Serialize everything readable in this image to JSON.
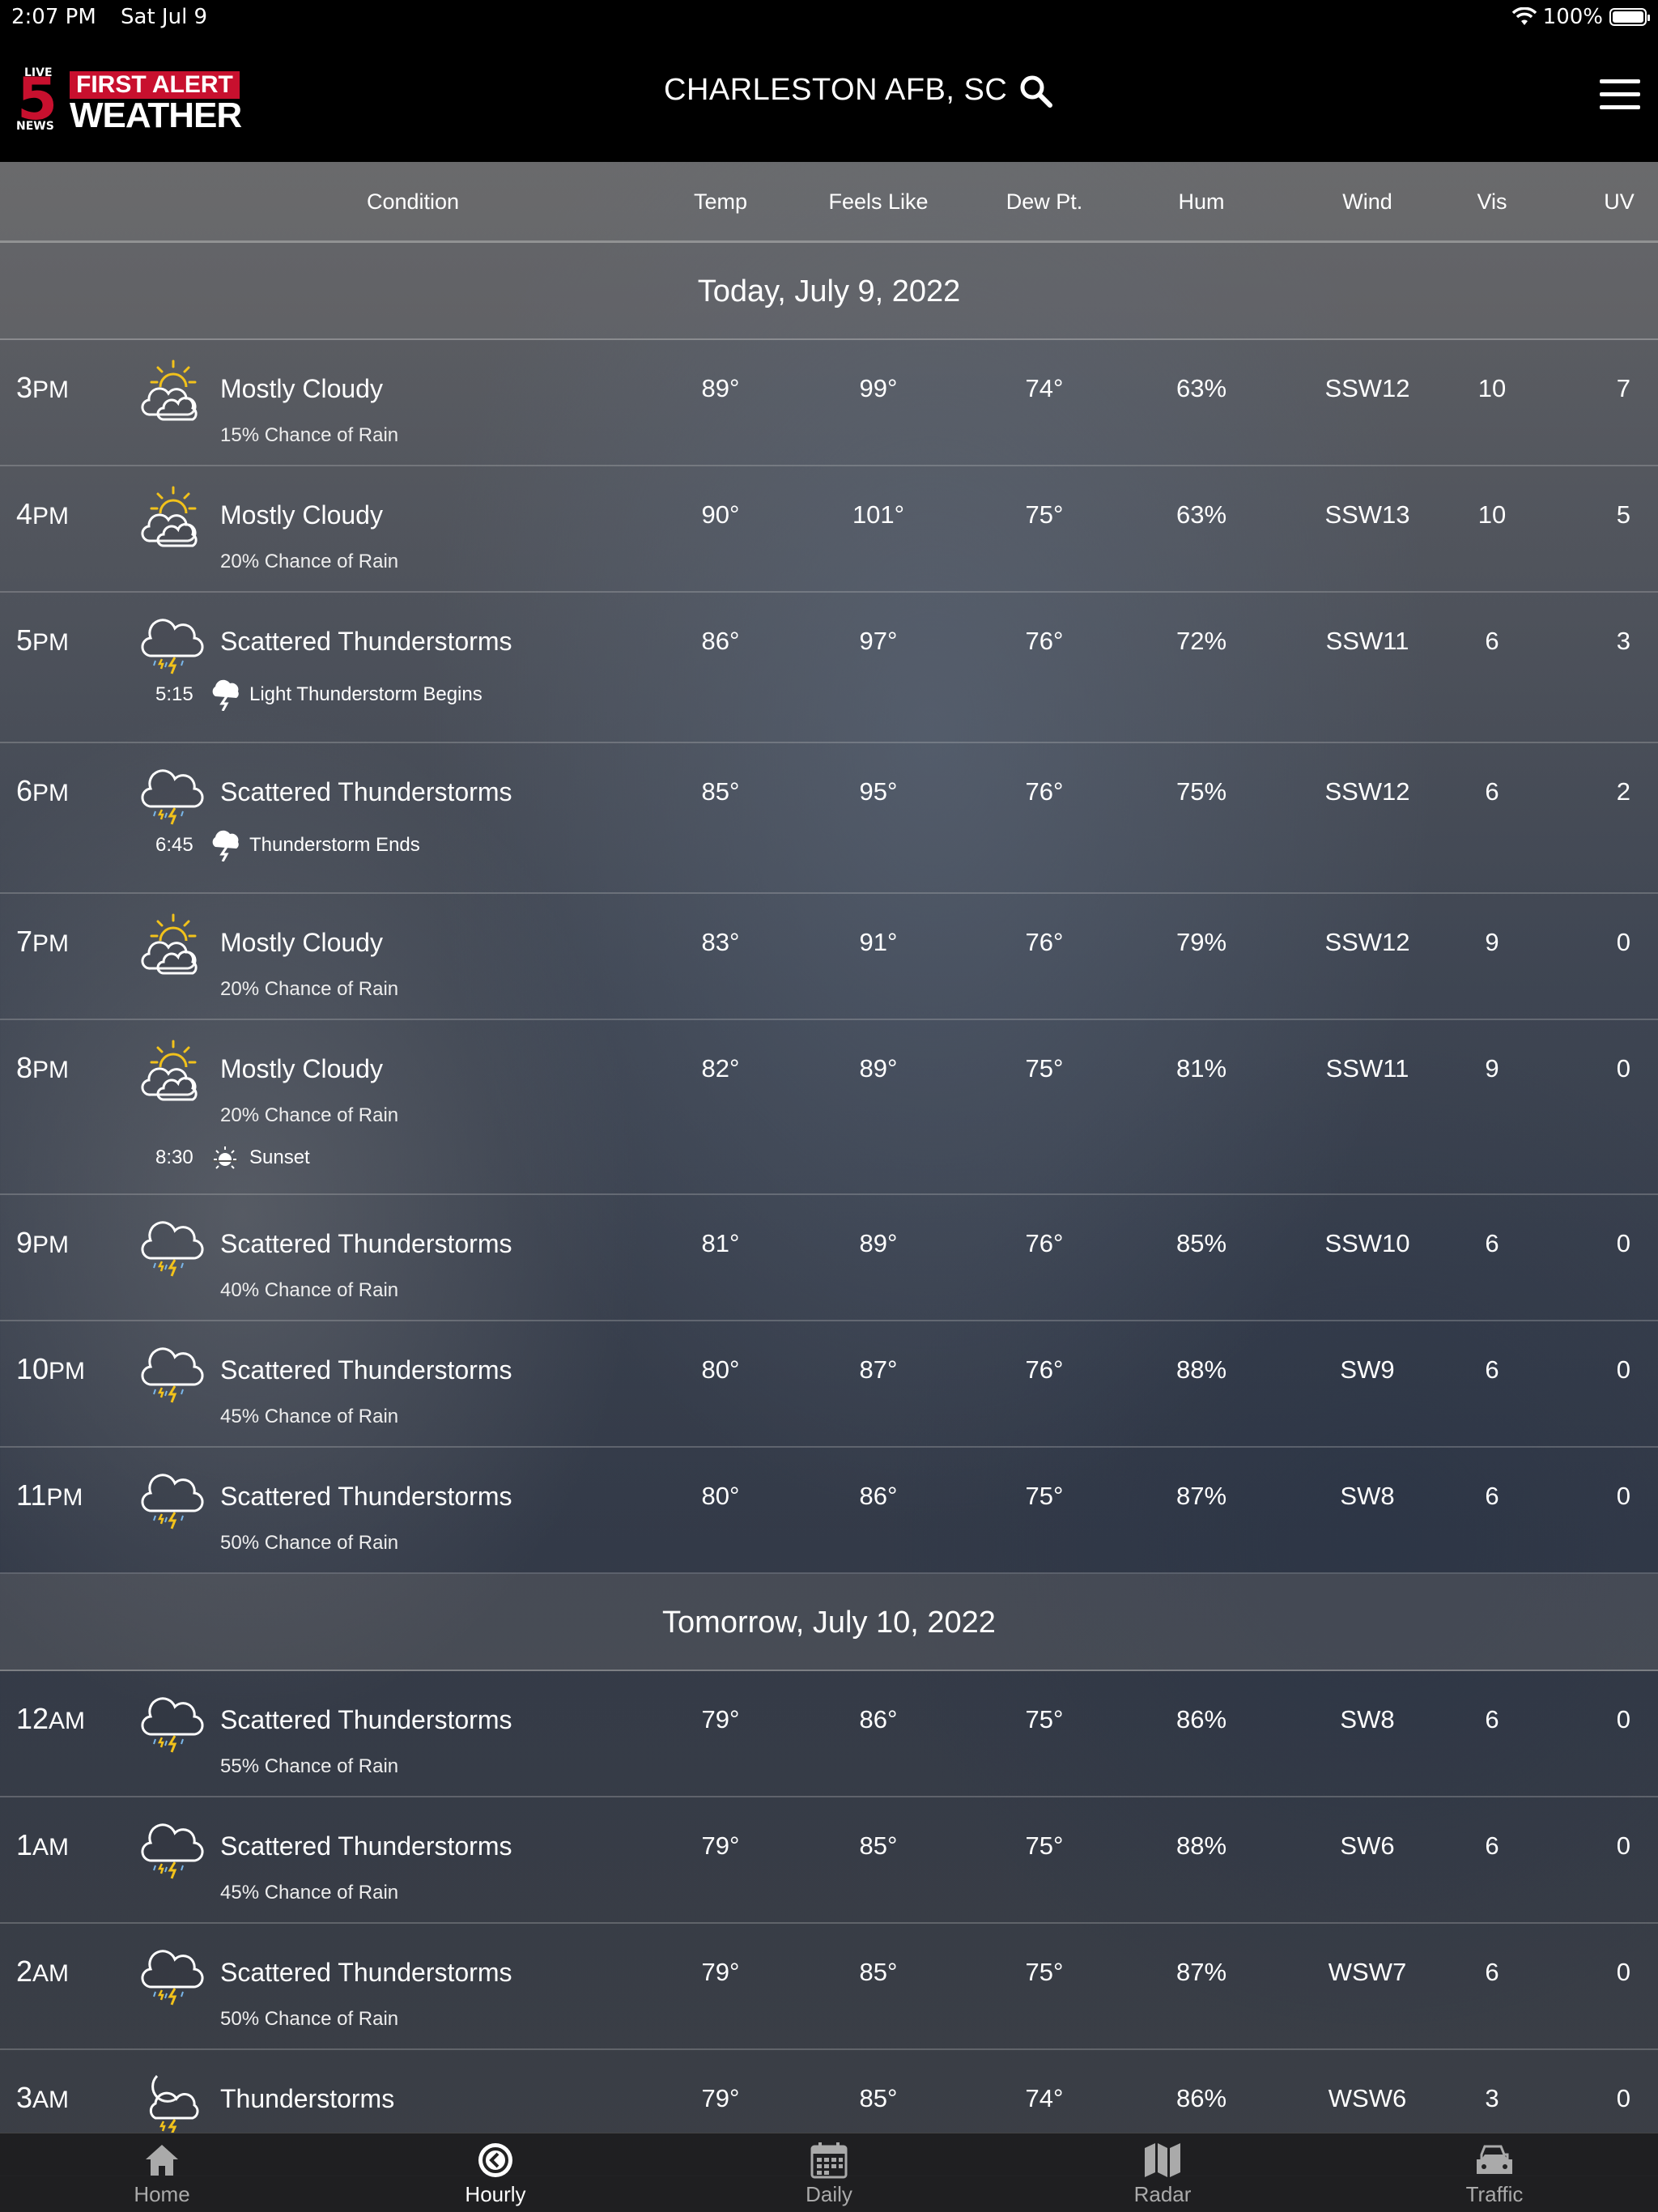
{
  "status_bar": {
    "time": "2:07 PM",
    "date": "Sat Jul 9",
    "battery": "100%"
  },
  "header": {
    "logo": {
      "live": "LIVE",
      "five": "5",
      "news": "NEWS",
      "line1": "FIRST ALERT",
      "line2": "WEATHER"
    },
    "location": "CHARLESTON AFB, SC"
  },
  "columns": {
    "condition": "Condition",
    "temp": "Temp",
    "feels": "Feels Like",
    "dew": "Dew Pt.",
    "hum": "Hum",
    "wind": "Wind",
    "vis": "Vis",
    "uv": "UV"
  },
  "days": {
    "today": "Today, July 9, 2022",
    "tomorrow": "Tomorrow, July 10, 2022"
  },
  "hours": [
    {
      "hour": "3",
      "ampm": "PM",
      "icon": "partly-cloudy-sun-icon",
      "condition": "Mostly Cloudy",
      "chance": "15% Chance of Rain",
      "temp": "89°",
      "feels": "99°",
      "dew": "74°",
      "hum": "63%",
      "wind": "SSW12",
      "vis": "10",
      "uv": "7"
    },
    {
      "hour": "4",
      "ampm": "PM",
      "icon": "partly-cloudy-sun-icon",
      "condition": "Mostly Cloudy",
      "chance": "20% Chance of Rain",
      "temp": "90°",
      "feels": "101°",
      "dew": "75°",
      "hum": "63%",
      "wind": "SSW13",
      "vis": "10",
      "uv": "5"
    },
    {
      "hour": "5",
      "ampm": "PM",
      "icon": "thunderstorm-cloud-icon",
      "condition": "Scattered Thunderstorms",
      "chance": "",
      "temp": "86°",
      "feels": "97°",
      "dew": "76°",
      "hum": "72%",
      "wind": "SSW11",
      "vis": "6",
      "uv": "3",
      "event": {
        "time": "5:15",
        "icon": "thunder-cloud-icon",
        "text": "Light Thunderstorm Begins"
      }
    },
    {
      "hour": "6",
      "ampm": "PM",
      "icon": "thunderstorm-cloud-icon",
      "condition": "Scattered Thunderstorms",
      "chance": "",
      "temp": "85°",
      "feels": "95°",
      "dew": "76°",
      "hum": "75%",
      "wind": "SSW12",
      "vis": "6",
      "uv": "2",
      "event": {
        "time": "6:45",
        "icon": "thunder-cloud-icon",
        "text": "Thunderstorm Ends"
      }
    },
    {
      "hour": "7",
      "ampm": "PM",
      "icon": "partly-cloudy-sun-icon",
      "condition": "Mostly Cloudy",
      "chance": "20% Chance of Rain",
      "temp": "83°",
      "feels": "91°",
      "dew": "76°",
      "hum": "79%",
      "wind": "SSW12",
      "vis": "9",
      "uv": "0"
    },
    {
      "hour": "8",
      "ampm": "PM",
      "icon": "partly-cloudy-sun-icon",
      "condition": "Mostly Cloudy",
      "chance": "20% Chance of Rain",
      "temp": "82°",
      "feels": "89°",
      "dew": "75°",
      "hum": "81%",
      "wind": "SSW11",
      "vis": "9",
      "uv": "0",
      "event": {
        "time": "8:30",
        "icon": "sunset-icon",
        "text": "Sunset"
      }
    },
    {
      "hour": "9",
      "ampm": "PM",
      "icon": "thunderstorm-cloud-icon",
      "condition": "Scattered Thunderstorms",
      "chance": "40% Chance of Rain",
      "temp": "81°",
      "feels": "89°",
      "dew": "76°",
      "hum": "85%",
      "wind": "SSW10",
      "vis": "6",
      "uv": "0"
    },
    {
      "hour": "10",
      "ampm": "PM",
      "icon": "thunderstorm-cloud-icon",
      "condition": "Scattered Thunderstorms",
      "chance": "45% Chance of Rain",
      "temp": "80°",
      "feels": "87°",
      "dew": "76°",
      "hum": "88%",
      "wind": "SW9",
      "vis": "6",
      "uv": "0"
    },
    {
      "hour": "11",
      "ampm": "PM",
      "icon": "thunderstorm-cloud-icon",
      "condition": "Scattered Thunderstorms",
      "chance": "50% Chance of Rain",
      "temp": "80°",
      "feels": "86°",
      "dew": "75°",
      "hum": "87%",
      "wind": "SW8",
      "vis": "6",
      "uv": "0"
    },
    {
      "hour": "12",
      "ampm": "AM",
      "icon": "thunderstorm-cloud-icon",
      "condition": "Scattered Thunderstorms",
      "chance": "55% Chance of Rain",
      "temp": "79°",
      "feels": "86°",
      "dew": "75°",
      "hum": "86%",
      "wind": "SW8",
      "vis": "6",
      "uv": "0"
    },
    {
      "hour": "1",
      "ampm": "AM",
      "icon": "thunderstorm-cloud-icon",
      "condition": "Scattered Thunderstorms",
      "chance": "45% Chance of Rain",
      "temp": "79°",
      "feels": "85°",
      "dew": "75°",
      "hum": "88%",
      "wind": "SW6",
      "vis": "6",
      "uv": "0"
    },
    {
      "hour": "2",
      "ampm": "AM",
      "icon": "thunderstorm-cloud-icon",
      "condition": "Scattered Thunderstorms",
      "chance": "50% Chance of Rain",
      "temp": "79°",
      "feels": "85°",
      "dew": "75°",
      "hum": "87%",
      "wind": "WSW7",
      "vis": "6",
      "uv": "0"
    },
    {
      "hour": "3",
      "ampm": "AM",
      "icon": "moon-thunderstorm-icon",
      "condition": "Thunderstorms",
      "chance": "",
      "temp": "79°",
      "feels": "85°",
      "dew": "74°",
      "hum": "86%",
      "wind": "WSW6",
      "vis": "3",
      "uv": "0"
    }
  ],
  "tabs": [
    {
      "label": "Home",
      "icon": "home-icon"
    },
    {
      "label": "Hourly",
      "icon": "clock-icon"
    },
    {
      "label": "Daily",
      "icon": "calendar-icon"
    },
    {
      "label": "Radar",
      "icon": "map-icon"
    },
    {
      "label": "Traffic",
      "icon": "car-icon"
    }
  ],
  "colors": {
    "brand_red": "#c8102e",
    "sun": "#f2c21b",
    "bolt": "#f2c21b",
    "rain": "#7ab6e8"
  }
}
